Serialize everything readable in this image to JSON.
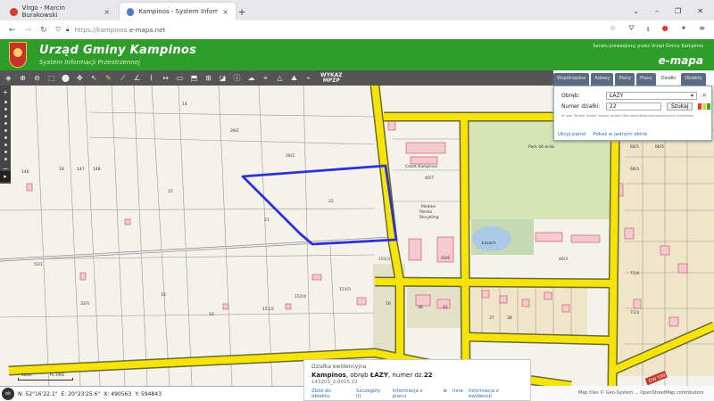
{
  "browser": {
    "tabs": [
      {
        "label": "Virgo - Marcin Burakowski",
        "active": false
      },
      {
        "label": "Kampinos - System Informacji",
        "active": true
      }
    ],
    "url_prefix": "https://kampinos.",
    "url_domain": "e-mapa.net"
  },
  "header": {
    "title": "Urząd Gminy Kampinos",
    "subtitle": "System Informacji Przestrzennej",
    "service_note": "Serwis prowadzony przez Urząd Gminy Kampinos",
    "brand": "e-mapa"
  },
  "toolbar": {
    "wykaz_l1": "WYKAZ",
    "wykaz_l2": "MPZP"
  },
  "panel": {
    "tabs": [
      "Współrzędne",
      "Adresy",
      "Plany",
      "Plany",
      "Działki",
      "Obiekty"
    ],
    "active_tab": 4,
    "obreb_label": "Obręb:",
    "obreb_value": "ŁAZY",
    "numer_label": "Numer działki:",
    "numer_value": "22",
    "search_button": "Szukaj",
    "hint": "W pole \"Numer działki\" można wpisać kilka identyfikatorów oddzielonych średnikiem",
    "link_hide": "Ukryj panel",
    "link_show_all": "Pokaż w jednym oknie"
  },
  "map_labels": [
    {
      "text": "Cezet Kampinos"
    },
    {
      "text": "Park 44-orski"
    },
    {
      "text": "Medien"
    },
    {
      "text": "Polska"
    },
    {
      "text": "Recykling"
    },
    {
      "text": "Łazach"
    },
    {
      "text": "22"
    },
    {
      "text": "28/2"
    },
    {
      "text": "28/1"
    },
    {
      "text": "21"
    },
    {
      "text": "15"
    },
    {
      "text": "14"
    },
    {
      "text": "147"
    },
    {
      "text": "146"
    },
    {
      "text": "148"
    },
    {
      "text": "18"
    },
    {
      "text": "151/3"
    },
    {
      "text": "151/4"
    },
    {
      "text": "151/5"
    },
    {
      "text": "151/2"
    },
    {
      "text": "40/7"
    },
    {
      "text": "40/6"
    },
    {
      "text": "40/3"
    },
    {
      "text": "42"
    },
    {
      "text": "36"
    },
    {
      "text": "16"
    },
    {
      "text": "51/1"
    },
    {
      "text": "32/5"
    },
    {
      "text": "33"
    },
    {
      "text": "32"
    },
    {
      "text": "37"
    },
    {
      "text": "38"
    },
    {
      "text": "68/5"
    },
    {
      "text": "68/3"
    },
    {
      "text": "66/5"
    },
    {
      "text": "71/4"
    },
    {
      "text": "71/3"
    }
  ],
  "info": {
    "heading": "Działka ewidencyjna",
    "place": "Kampinos",
    "line_mid": ", obręb ",
    "obreb": "ŁAZY",
    "line_num": ", numer dz.",
    "numer": "22",
    "id": "143203_2.0015.22",
    "links": [
      "Zbliż do obiektu",
      "Szczegóły (I)",
      "Informacja z planu",
      "Inne",
      "Informacja z ewidencji"
    ]
  },
  "coords": {
    "ok": "ok",
    "n": "N: 52°16'22.1\"",
    "e": "E: 20°23'25.6\"",
    "x": "X: 490563",
    "y": "Y: 594843"
  },
  "scale": {
    "top": "PL-1992",
    "bottom": "100m"
  },
  "attribution": "Map tiles © Geo-System ... OpenStreetMap contributors",
  "road_label": "DW 580",
  "colors": {
    "header_green": "#2f9d2a",
    "road_yellow": "#f6e30a",
    "parcel_highlight": "#2c32d6",
    "toolbar": "#555555"
  }
}
